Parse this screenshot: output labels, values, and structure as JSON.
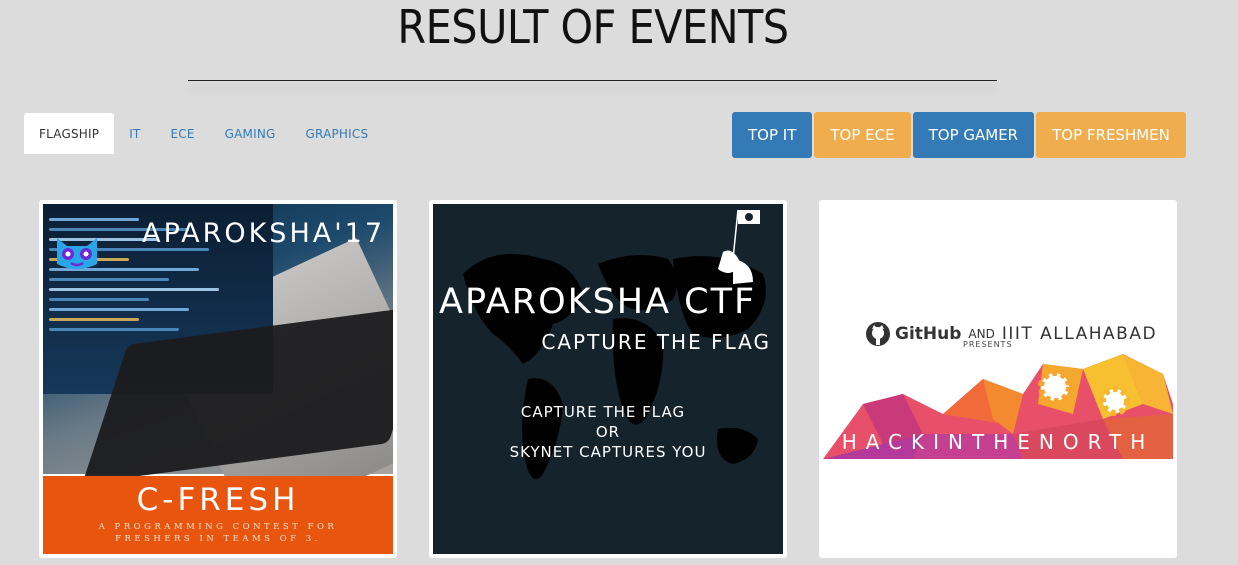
{
  "header": {
    "title": "RESULT OF EVENTS"
  },
  "tabs": [
    {
      "label": "FLAGSHIP",
      "active": true
    },
    {
      "label": "IT",
      "active": false
    },
    {
      "label": "ECE",
      "active": false
    },
    {
      "label": "GAMING",
      "active": false
    },
    {
      "label": "GRAPHICS",
      "active": false
    }
  ],
  "top_buttons": [
    {
      "label": "TOP IT",
      "color": "#337ab7"
    },
    {
      "label": "TOP ECE",
      "color": "#f0ad4e"
    },
    {
      "label": "TOP GAMER",
      "color": "#337ab7"
    },
    {
      "label": "TOP FRESHMEN",
      "color": "#f0ad4e"
    }
  ],
  "cards": [
    {
      "heading": "APAROKSHA'17",
      "title": "C-FRESH",
      "subtitle_line1": "A PROGRAMMING CONTEST FOR",
      "subtitle_line2": "FRESHERS IN TEAMS OF 3.",
      "accent": "#e8550e"
    },
    {
      "title": "APAROKSHA CTF",
      "subtitle": "CAPTURE THE FLAG",
      "tag_line1": "CAPTURE THE FLAG",
      "tag_line2": "OR",
      "tag_line3": "SKYNET CAPTURES YOU",
      "accent": "#14232c"
    },
    {
      "github": "GitHub",
      "and": "AND",
      "org": "IIIT ALLAHABAD",
      "presents": "PRESENTS",
      "event": "HACKINTHENORTH"
    }
  ],
  "icons": {
    "card1_logo": "mascot-logo-icon",
    "card2_flag": "pirate-flag-icon",
    "card3_github": "github-octocat-icon"
  }
}
